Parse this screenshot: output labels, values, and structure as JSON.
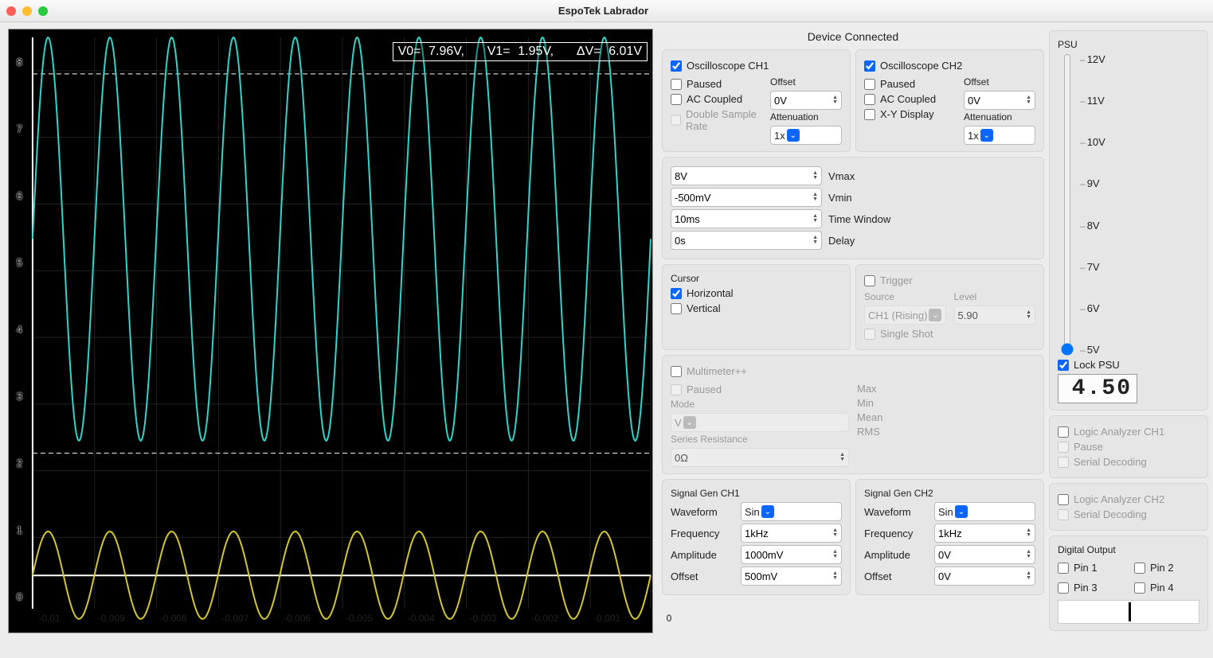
{
  "window": {
    "title": "EspoTek Labrador"
  },
  "status": "Device Connected",
  "readout": {
    "v0_label": "V0=",
    "v0": "7.96V,",
    "v1_label": "V1=",
    "v1": "1.95V,",
    "dv_label": "ΔV=",
    "dv": "6.01V"
  },
  "yaxis": [
    "8",
    "7",
    "6",
    "5",
    "4",
    "3",
    "2",
    "1",
    "0"
  ],
  "xaxis": [
    "-0.01",
    "-0.009",
    "-0.008",
    "-0.007",
    "-0.006",
    "-0.005",
    "-0.004",
    "-0.003",
    "-0.002",
    "-0.001",
    "0"
  ],
  "ch1": {
    "title": "Oscilloscope CH1",
    "paused": "Paused",
    "ac": "AC Coupled",
    "dsr": "Double Sample Rate",
    "offset_lbl": "Offset",
    "offset": "0V",
    "atten_lbl": "Attenuation",
    "atten": "1x"
  },
  "ch2": {
    "title": "Oscilloscope CH2",
    "paused": "Paused",
    "ac": "AC Coupled",
    "xy": "X-Y Display",
    "offset_lbl": "Offset",
    "offset": "0V",
    "atten_lbl": "Attenuation",
    "atten": "1x"
  },
  "range": {
    "vmax": "8V",
    "vmax_lbl": "Vmax",
    "vmin": "-500mV",
    "vmin_lbl": "Vmin",
    "tw": "10ms",
    "tw_lbl": "Time Window",
    "delay": "0s",
    "delay_lbl": "Delay"
  },
  "cursor": {
    "title": "Cursor",
    "horiz": "Horizontal",
    "vert": "Vertical"
  },
  "trigger": {
    "title": "Trigger",
    "src_lbl": "Source",
    "src": "CH1 (Rising)",
    "level_lbl": "Level",
    "level": "5.90",
    "single": "Single Shot"
  },
  "mm": {
    "title": "Multimeter++",
    "paused": "Paused",
    "mode_lbl": "Mode",
    "mode": "V",
    "sr_lbl": "Series Resistance",
    "sr": "0Ω",
    "max": "Max",
    "min": "Min",
    "mean": "Mean",
    "rms": "RMS"
  },
  "sg1": {
    "title": "Signal Gen CH1",
    "wf_lbl": "Waveform",
    "wf": "Sin",
    "freq_lbl": "Frequency",
    "freq": "1kHz",
    "amp_lbl": "Amplitude",
    "amp": "1000mV",
    "off_lbl": "Offset",
    "off": "500mV"
  },
  "sg2": {
    "title": "Signal Gen CH2",
    "wf_lbl": "Waveform",
    "wf": "Sin",
    "freq_lbl": "Frequency",
    "freq": "1kHz",
    "amp_lbl": "Amplitude",
    "amp": "0V",
    "off_lbl": "Offset",
    "off": "0V"
  },
  "psu": {
    "title": "PSU",
    "ticks": [
      "12V",
      "11V",
      "10V",
      "9V",
      "8V",
      "7V",
      "6V",
      "5V"
    ],
    "lock": "Lock PSU",
    "value": "4.50"
  },
  "la1": {
    "title": "Logic Analyzer CH1",
    "pause": "Pause",
    "serial": "Serial Decoding"
  },
  "la2": {
    "title": "Logic Analyzer CH2",
    "serial": "Serial Decoding"
  },
  "do": {
    "title": "Digital Output",
    "p1": "Pin 1",
    "p2": "Pin 2",
    "p3": "Pin 3",
    "p4": "Pin 4"
  },
  "chart_data": {
    "type": "line",
    "xlim": [
      -0.01,
      0
    ],
    "ylim": [
      -0.5,
      8
    ],
    "xlabel": "",
    "ylabel": "",
    "cursors": {
      "y": [
        7.96,
        1.95
      ]
    },
    "series": [
      {
        "name": "CH1",
        "color": "#2dd6c9",
        "shape": "sine",
        "freq_hz": 1000,
        "amplitude_v": 3.0,
        "offset_v": 5.0,
        "min_v": 1.95,
        "max_v": 7.96
      },
      {
        "name": "CH2",
        "color": "#d6c62d",
        "shape": "sine",
        "freq_hz": 1000,
        "amplitude_v": 0.65,
        "offset_v": 0.0,
        "min_v": -0.65,
        "max_v": 0.65
      }
    ]
  }
}
